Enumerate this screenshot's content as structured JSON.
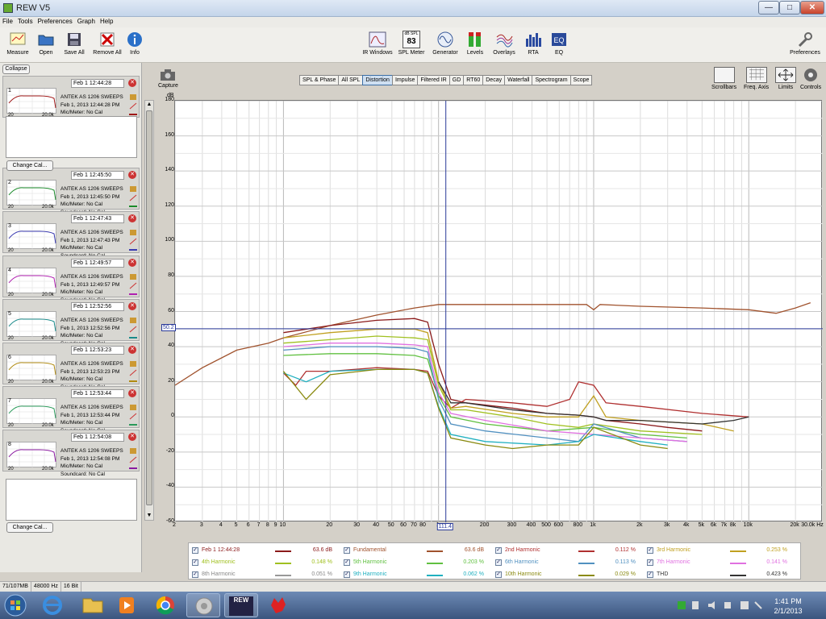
{
  "window": {
    "title": "REW V5",
    "minimize": "—",
    "maximize": "□",
    "close": "✕"
  },
  "menu": [
    "File",
    "Tools",
    "Preferences",
    "Graph",
    "Help"
  ],
  "toolbar_left": [
    {
      "label": "Measure",
      "icon": "measure-icon"
    },
    {
      "label": "Open",
      "icon": "open-icon"
    },
    {
      "label": "Save All",
      "icon": "save-all-icon"
    },
    {
      "label": "Remove All",
      "icon": "remove-all-icon"
    },
    {
      "label": "Info",
      "icon": "info-icon"
    }
  ],
  "toolbar_center": [
    {
      "label": "IR Windows",
      "icon": "ir-windows-icon"
    },
    {
      "label": "SPL Meter",
      "icon": "spl-meter-icon",
      "badge_unit": "dB SPL",
      "badge_value": "83"
    },
    {
      "label": "Generator",
      "icon": "generator-icon"
    },
    {
      "label": "Levels",
      "icon": "levels-icon"
    },
    {
      "label": "Overlays",
      "icon": "overlays-icon"
    },
    {
      "label": "RTA",
      "icon": "rta-icon"
    },
    {
      "label": "EQ",
      "icon": "eq-icon"
    }
  ],
  "preferences_label": "Preferences",
  "sidepanel": {
    "collapse": "Collapse",
    "change_cal": "Change Cal...",
    "tick_lo": "20",
    "tick_hi": "20.0k",
    "measurements": [
      {
        "num": "1",
        "date": "Feb 1 12:44:28",
        "name": "ANTEK AS 1206 SWEEPS",
        "full_date": "Feb 1, 2013 12:44:28 PM",
        "mic": "Mic/Meter: No Cal",
        "soundcard": "Soundcard: No Cal",
        "color": "#a01818"
      },
      {
        "num": "2",
        "date": "Feb 1 12:45:50",
        "name": "ANTEK AS 1206 SWEEPS",
        "full_date": "Feb 1, 2013 12:45:50 PM",
        "mic": "Mic/Meter: No Cal",
        "soundcard": "Soundcard: No Cal",
        "color": "#1a8a2a"
      },
      {
        "num": "3",
        "date": "Feb 1 12:47:43",
        "name": "ANTEK AS 1206 SWEEPS",
        "full_date": "Feb 1, 2013 12:47:43 PM",
        "mic": "Mic/Meter: No Cal",
        "soundcard": "Soundcard: No Cal",
        "color": "#3a3ab0"
      },
      {
        "num": "4",
        "date": "Feb 1 12:49:57",
        "name": "ANTEK AS 1206 SWEEPS",
        "full_date": "Feb 1, 2013 12:49:57 PM",
        "mic": "Mic/Meter: No Cal",
        "soundcard": "Soundcard: No Cal",
        "color": "#b020b0"
      },
      {
        "num": "5",
        "date": "Feb 1 12:52:56",
        "name": "ANTEK AS 1206 SWEEPS",
        "full_date": "Feb 1, 2013 12:52:56 PM",
        "mic": "Mic/Meter: No Cal",
        "soundcard": "Soundcard: No Cal",
        "color": "#1a8a8a"
      },
      {
        "num": "6",
        "date": "Feb 1 12:53:23",
        "name": "ANTEK AS 1206 SWEEPS",
        "full_date": "Feb 1, 2013 12:53:23 PM",
        "mic": "Mic/Meter: No Cal",
        "soundcard": "Soundcard: No Cal",
        "color": "#b08a10"
      },
      {
        "num": "7",
        "date": "Feb 1 12:53:44",
        "name": "ANTEK AS 1206 SWEEPS",
        "full_date": "Feb 1, 2013 12:53:44 PM",
        "mic": "Mic/Meter: No Cal",
        "soundcard": "Soundcard: No Cal",
        "color": "#2a9a5a"
      },
      {
        "num": "8",
        "date": "Feb 1 12:54:08",
        "name": "ANTEK AS 1206 SWEEPS",
        "full_date": "Feb 1, 2013 12:54:08 PM",
        "mic": "Mic/Meter: No Cal",
        "soundcard": "Soundcard: No Cal",
        "color": "#8a1aa0"
      }
    ]
  },
  "capture_label": "Capture",
  "graph_tabs": [
    "SPL & Phase",
    "All SPL",
    "Distortion",
    "Impulse",
    "Filtered IR",
    "GD",
    "RT60",
    "Decay",
    "Waterfall",
    "Spectrogram",
    "Scope"
  ],
  "active_tab": "Distortion",
  "right_tools": [
    {
      "label": "Scrollbars",
      "icon": "scrollbars-icon"
    },
    {
      "label": "Freq. Axis",
      "icon": "freq-axis-icon"
    },
    {
      "label": "Limits",
      "icon": "limits-icon"
    },
    {
      "label": "Controls",
      "icon": "controls-icon"
    }
  ],
  "cursor": {
    "x_readout": "111.4",
    "y_readout": "50.2"
  },
  "chart_data": {
    "type": "line",
    "title": "",
    "ylabel": "dB",
    "xlabel": "Hz",
    "x_scale": "log",
    "xlim": [
      2,
      30000
    ],
    "ylim": [
      -60,
      180
    ],
    "y_ticks": [
      180,
      160,
      140,
      120,
      100,
      80,
      60,
      40,
      20,
      0,
      -20,
      -40,
      -60
    ],
    "x_tick_labels": [
      {
        "v": 2,
        "t": "2"
      },
      {
        "v": 3,
        "t": "3"
      },
      {
        "v": 4,
        "t": "4"
      },
      {
        "v": 5,
        "t": "5"
      },
      {
        "v": 6,
        "t": "6"
      },
      {
        "v": 7,
        "t": "7"
      },
      {
        "v": 8,
        "t": "8"
      },
      {
        "v": 9,
        "t": "9"
      },
      {
        "v": 10,
        "t": "10"
      },
      {
        "v": 20,
        "t": "20"
      },
      {
        "v": 30,
        "t": "30"
      },
      {
        "v": 40,
        "t": "40"
      },
      {
        "v": 50,
        "t": "50"
      },
      {
        "v": 60,
        "t": "60"
      },
      {
        "v": 70,
        "t": "70"
      },
      {
        "v": 80,
        "t": "80"
      },
      {
        "v": 100,
        "t": "1"
      },
      {
        "v": 200,
        "t": "200"
      },
      {
        "v": 300,
        "t": "300"
      },
      {
        "v": 400,
        "t": "400"
      },
      {
        "v": 500,
        "t": "500"
      },
      {
        "v": 600,
        "t": "600"
      },
      {
        "v": 800,
        "t": "800"
      },
      {
        "v": 1000,
        "t": "1k"
      },
      {
        "v": 2000,
        "t": "2k"
      },
      {
        "v": 3000,
        "t": "3k"
      },
      {
        "v": 4000,
        "t": "4k"
      },
      {
        "v": 5000,
        "t": "5k"
      },
      {
        "v": 6000,
        "t": "6k"
      },
      {
        "v": 7000,
        "t": "7k"
      },
      {
        "v": 8000,
        "t": "8k"
      },
      {
        "v": 10000,
        "t": "10k"
      },
      {
        "v": 20000,
        "t": "20k"
      },
      {
        "v": 30000,
        "t": "30.0k Hz"
      }
    ],
    "cursor_x": 111.4,
    "cursor_y": 50.2,
    "series": [
      {
        "name": "Fundamental",
        "color": "#a0522d",
        "x": [
          2,
          3,
          5,
          8,
          10,
          20,
          40,
          70,
          100,
          200,
          500,
          900,
          1000,
          1100,
          2000,
          5000,
          10000,
          15000,
          20000,
          25000
        ],
        "y": [
          18,
          28,
          38,
          42,
          45,
          52,
          58,
          62,
          64,
          64,
          64,
          64,
          61,
          64,
          63,
          62,
          61,
          59,
          62,
          65
        ]
      },
      {
        "name": "Feb 1 12:44:28",
        "color": "#8b1a1a",
        "x": [
          10,
          20,
          40,
          70,
          85,
          100,
          120,
          150,
          300,
          500,
          800,
          1000,
          1200,
          2000,
          3000,
          5000
        ],
        "y": [
          48,
          52,
          55,
          56,
          54,
          30,
          10,
          8,
          5,
          2,
          1,
          0,
          -2,
          -4,
          -6,
          -8
        ]
      },
      {
        "name": "2nd Harmonic",
        "color": "#b03030",
        "x": [
          10,
          12,
          14,
          20,
          40,
          70,
          85,
          100,
          120,
          150,
          300,
          500,
          700,
          800,
          1000,
          1200,
          2000,
          5000,
          10000
        ],
        "y": [
          25,
          18,
          26,
          26,
          28,
          27,
          26,
          12,
          5,
          10,
          8,
          6,
          10,
          20,
          18,
          8,
          6,
          2,
          0
        ]
      },
      {
        "name": "3rd Harmonic",
        "color": "#c0a020",
        "x": [
          10,
          20,
          40,
          70,
          85,
          100,
          120,
          150,
          300,
          500,
          800,
          1000,
          1200,
          2000,
          5000,
          8000
        ],
        "y": [
          45,
          48,
          50,
          50,
          48,
          20,
          5,
          6,
          2,
          0,
          0,
          12,
          0,
          -2,
          -4,
          -8
        ]
      },
      {
        "name": "4th Harmonic",
        "color": "#a0c020",
        "x": [
          10,
          20,
          40,
          70,
          85,
          100,
          120,
          150,
          300,
          500,
          800,
          1000,
          2000,
          5000
        ],
        "y": [
          42,
          44,
          46,
          45,
          44,
          18,
          4,
          4,
          0,
          -4,
          -6,
          -4,
          -8,
          -10
        ]
      },
      {
        "name": "5th Harmonic",
        "color": "#60c040",
        "x": [
          10,
          20,
          40,
          70,
          85,
          100,
          120,
          200,
          500,
          1000,
          2000,
          4000
        ],
        "y": [
          35,
          36,
          36,
          35,
          33,
          12,
          0,
          -4,
          -8,
          -6,
          -10,
          -12
        ]
      },
      {
        "name": "6th Harmonic",
        "color": "#5090c0",
        "x": [
          10,
          20,
          40,
          70,
          85,
          100,
          120,
          200,
          500,
          800,
          1000,
          2000,
          4000
        ],
        "y": [
          38,
          40,
          40,
          39,
          37,
          10,
          -4,
          -8,
          -12,
          -14,
          -4,
          -12,
          -14
        ]
      },
      {
        "name": "7th Harmonic",
        "color": "#e070e0",
        "x": [
          10,
          20,
          40,
          70,
          85,
          100,
          120,
          200,
          500,
          1000,
          2000,
          4000
        ],
        "y": [
          40,
          42,
          42,
          41,
          40,
          14,
          2,
          -2,
          -8,
          -10,
          -12,
          -14
        ]
      },
      {
        "name": "9th Harmonic",
        "color": "#20b0c0",
        "x": [
          10,
          14,
          20,
          40,
          70,
          85,
          100,
          120,
          200,
          500,
          800,
          1000,
          2000,
          3000
        ],
        "y": [
          25,
          20,
          26,
          27,
          27,
          25,
          6,
          -10,
          -14,
          -16,
          -14,
          -10,
          -14,
          -16
        ]
      },
      {
        "name": "10th Harmonic",
        "color": "#8a8a10",
        "x": [
          10,
          14,
          20,
          40,
          70,
          85,
          100,
          120,
          200,
          300,
          500,
          800,
          1000,
          2000,
          3000
        ],
        "y": [
          26,
          10,
          24,
          27,
          27,
          25,
          5,
          -12,
          -16,
          -18,
          -16,
          -16,
          -6,
          -16,
          -18
        ]
      },
      {
        "name": "THD",
        "color": "#333333",
        "x": [
          100,
          120,
          150,
          300,
          500,
          800,
          1000,
          1200,
          2000,
          5000,
          8000,
          10000
        ],
        "y": [
          20,
          8,
          8,
          4,
          2,
          1,
          0,
          -2,
          -2,
          -4,
          -2,
          0
        ]
      }
    ],
    "legend": [
      {
        "name": "Feb 1 12:44:28",
        "value": "63.6 dB",
        "color": "#8b1a1a",
        "name_color": "#8b1a1a"
      },
      {
        "name": "Fundamental",
        "value": "63.6 dB",
        "color": "#a0522d",
        "name_color": "#a0522d"
      },
      {
        "name": "2nd Harmonic",
        "value": "0.112 %",
        "color": "#b03030",
        "name_color": "#b03030"
      },
      {
        "name": "3rd Harmonic",
        "value": "0.253 %",
        "color": "#c0a020",
        "name_color": "#c0a020"
      },
      {
        "name": "4th Harmonic",
        "value": "0.148 %",
        "color": "#a0c020",
        "name_color": "#a0c020"
      },
      {
        "name": "5th Harmonic",
        "value": "0.203 %",
        "color": "#60c040",
        "name_color": "#60c040"
      },
      {
        "name": "6th Harmonic",
        "value": "0.113 %",
        "color": "#5090c0",
        "name_color": "#5090c0"
      },
      {
        "name": "7th Harmonic",
        "value": "0.141 %",
        "color": "#e070e0",
        "name_color": "#e070e0"
      },
      {
        "name": "8th Harmonic",
        "value": "0.051 %",
        "color": "#999999",
        "name_color": "#888888"
      },
      {
        "name": "9th Harmonic",
        "value": "0.062 %",
        "color": "#20b0c0",
        "name_color": "#20b0c0"
      },
      {
        "name": "10th Harmonic",
        "value": "0.029 %",
        "color": "#8a8a10",
        "name_color": "#8a8a10"
      },
      {
        "name": "THD",
        "value": "0.423 %",
        "color": "#333333",
        "name_color": "#333333"
      }
    ]
  },
  "statusbar": [
    "71/107MB",
    "48000 Hz",
    "16 Bit"
  ],
  "taskbar": {
    "time": "1:41 PM",
    "date": "2/1/2013",
    "rew_badge": "REW"
  }
}
